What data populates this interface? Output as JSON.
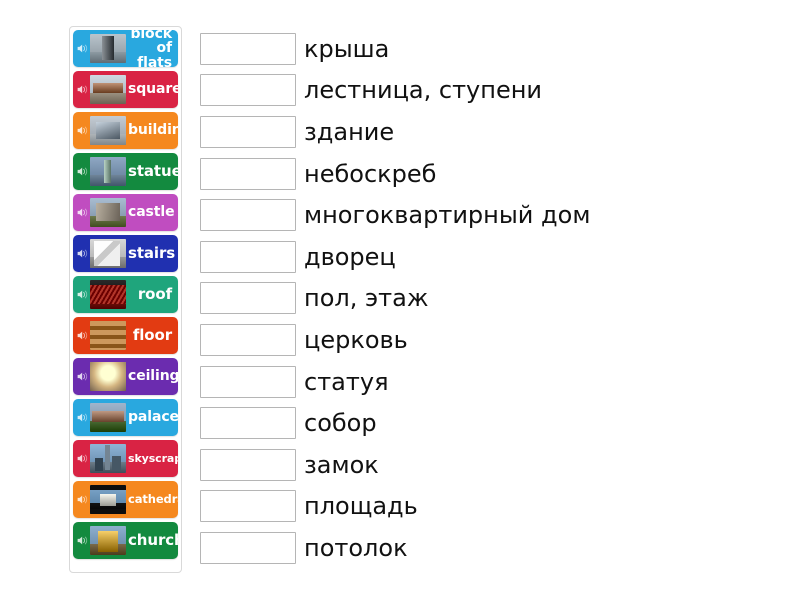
{
  "app": {
    "type": "match-up-drag-and-drop-activity",
    "background_color": "#ffffff"
  },
  "cards_panel": {
    "name": "word-cards-stack",
    "border_color": "#d9d9d9",
    "cards": [
      {
        "label": "block of flats",
        "color": "#29A8DF",
        "text_color": "#ffffff",
        "font_size": 14,
        "icon": "speaker-icon",
        "thumb": {
          "sky": "#b9c4cc",
          "ground": "#8d9aa2",
          "building": "#5d6368",
          "kind": "tower-block"
        }
      },
      {
        "label": "square",
        "color": "#D92344",
        "text_color": "#ffffff",
        "font_size": 14,
        "icon": "speaker-icon",
        "thumb": {
          "sky": "#cfd9e2",
          "ground": "#9a9080",
          "building": "#9c6f52",
          "kind": "town-square"
        }
      },
      {
        "label": "building",
        "color": "#F5881F",
        "text_color": "#ffffff",
        "font_size": 14,
        "icon": "speaker-icon",
        "thumb": {
          "sky": "#c4ccd4",
          "ground": "#aeb4b8",
          "building": "#8d99a4",
          "kind": "glass-pyramid"
        }
      },
      {
        "label": "statue",
        "color": "#138A3F",
        "text_color": "#ffffff",
        "font_size": 15,
        "icon": "speaker-icon",
        "thumb": {
          "sky": "#8fa8c4",
          "ground": "#6f8498",
          "building": "#8fa99b",
          "kind": "statue-of-liberty"
        }
      },
      {
        "label": "castle",
        "color": "#C04DC0",
        "text_color": "#ffffff",
        "font_size": 14,
        "icon": "speaker-icon",
        "thumb": {
          "sky": "#a9bdd1",
          "ground": "#6f7b4e",
          "building": "#8a8madd",
          "kind": "stone-castle"
        }
      },
      {
        "label": "stairs",
        "color": "#2030B0",
        "text_color": "#ffffff",
        "font_size": 15,
        "icon": "speaker-icon",
        "thumb": {
          "sky": "#d8d8d8",
          "ground": "#9a9a9a",
          "building": "#efefef",
          "kind": "staircase"
        }
      },
      {
        "label": "roof",
        "color": "#1FA57C",
        "text_color": "#ffffff",
        "font_size": 15,
        "icon": "speaker-icon",
        "thumb": {
          "sky": "#2a2a2a",
          "ground": "#7e1d12",
          "building": "#b2362a",
          "kind": "tiled-roof"
        }
      },
      {
        "label": "floor",
        "color": "#E23B12",
        "text_color": "#ffffff",
        "font_size": 15,
        "icon": "speaker-icon",
        "thumb": {
          "sky": "#c89a5c",
          "ground": "#8a5a2b",
          "building": "#a97438",
          "kind": "wooden-floor"
        }
      },
      {
        "label": "ceiling",
        "color": "#6B2CAF",
        "text_color": "#ffffff",
        "font_size": 14,
        "icon": "speaker-icon",
        "thumb": {
          "sky": "#d8b37a",
          "ground": "#7c6a58",
          "building": "#e3c490",
          "kind": "vaulted-ceiling"
        }
      },
      {
        "label": "palace",
        "color": "#29A8DF",
        "text_color": "#ffffff",
        "font_size": 14,
        "icon": "speaker-icon",
        "thumb": {
          "sky": "#9fb5cc",
          "ground": "#4a6b34",
          "building": "#96705a",
          "kind": "palace-facade"
        }
      },
      {
        "label": "skyscraper",
        "color": "#D92344",
        "text_color": "#ffffff",
        "font_size": 11,
        "icon": "speaker-icon",
        "thumb": {
          "sky": "#8fb4d6",
          "ground": "#6d7c88",
          "building": "#5a6b79",
          "kind": "skyscraper-tower"
        }
      },
      {
        "label": "cathedral",
        "color": "#F5881F",
        "text_color": "#ffffff",
        "font_size": 11.5,
        "icon": "speaker-icon",
        "thumb": {
          "sky": "#7fa8cc",
          "ground": "#121212",
          "building": "#d8d8d0",
          "kind": "cathedral-domes"
        }
      },
      {
        "label": "church",
        "color": "#138A3F",
        "text_color": "#ffffff",
        "font_size": 15,
        "icon": "speaker-icon",
        "thumb": {
          "sky": "#8fb0cf",
          "ground": "#7a6a4a",
          "building": "#c9a23c",
          "kind": "orthodox-church"
        }
      }
    ]
  },
  "answer_rows": [
    {
      "dropbox_value": "",
      "translation": "крыша"
    },
    {
      "dropbox_value": "",
      "translation": "лестница, ступени"
    },
    {
      "dropbox_value": "",
      "translation": "здание"
    },
    {
      "dropbox_value": "",
      "translation": "небоскреб"
    },
    {
      "dropbox_value": "",
      "translation": "многоквартирный дом"
    },
    {
      "dropbox_value": "",
      "translation": "дворец"
    },
    {
      "dropbox_value": "",
      "translation": "пол, этаж"
    },
    {
      "dropbox_value": "",
      "translation": "церковь"
    },
    {
      "dropbox_value": "",
      "translation": "статуя"
    },
    {
      "dropbox_value": "",
      "translation": "собор"
    },
    {
      "dropbox_value": "",
      "translation": "замок"
    },
    {
      "dropbox_value": "",
      "translation": "площадь"
    },
    {
      "dropbox_value": "",
      "translation": "потолок"
    }
  ]
}
